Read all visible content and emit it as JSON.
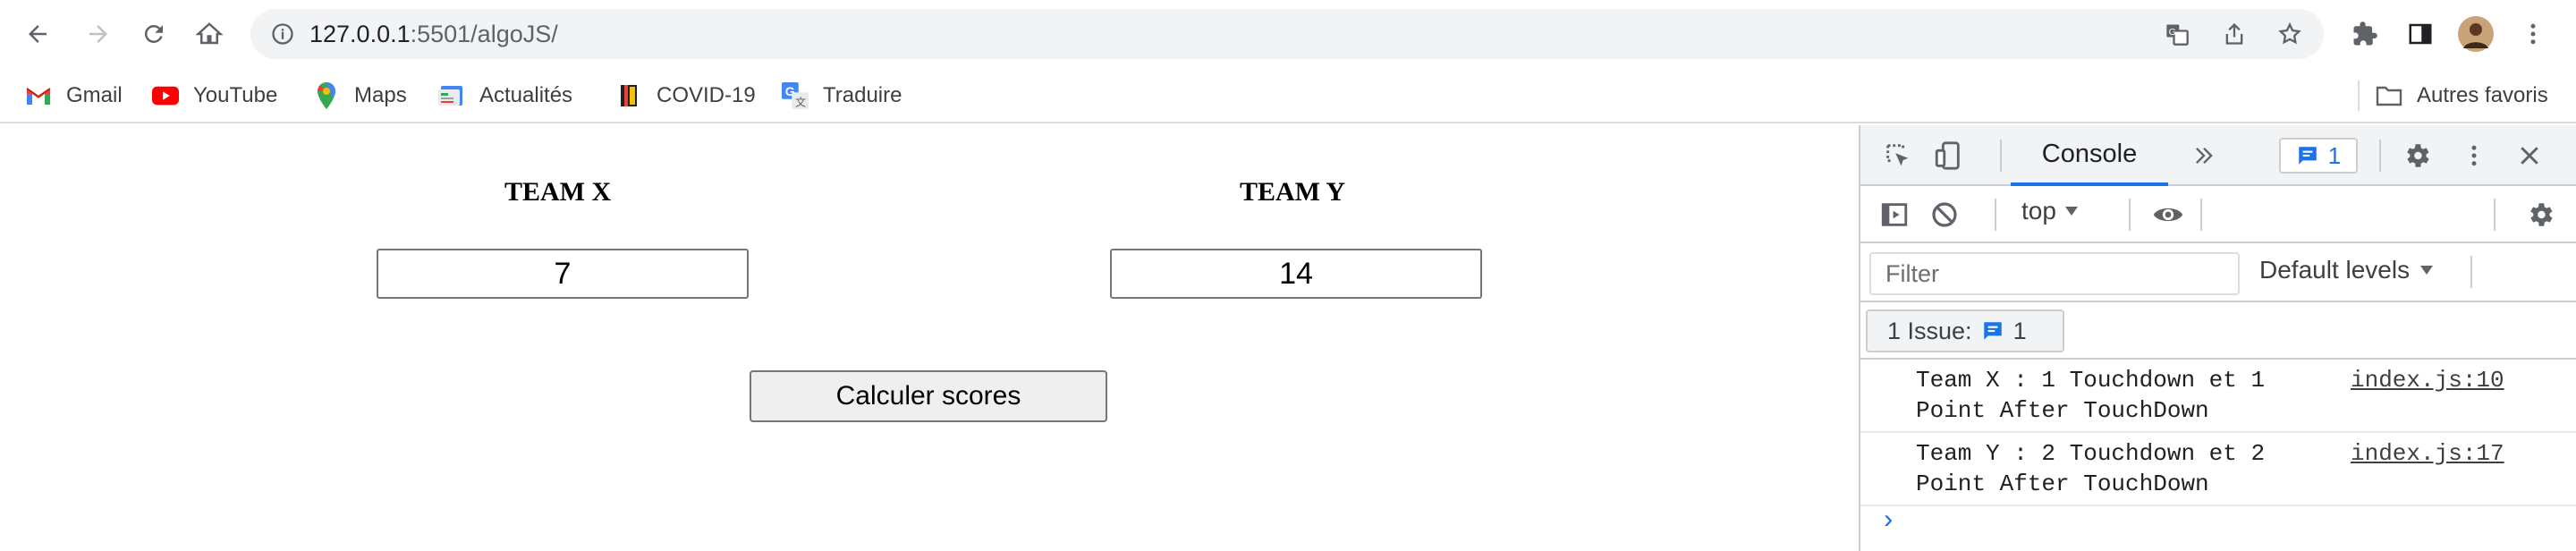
{
  "browser": {
    "url_host": "127.0.0.1",
    "url_rest": ":5501/algoJS/"
  },
  "bookmarks": {
    "items": [
      {
        "label": "Gmail",
        "icon": "gmail-icon"
      },
      {
        "label": "YouTube",
        "icon": "youtube-icon"
      },
      {
        "label": "Maps",
        "icon": "maps-icon"
      },
      {
        "label": "Actualités",
        "icon": "news-icon"
      },
      {
        "label": "COVID-19",
        "icon": "covid-icon"
      },
      {
        "label": "Traduire",
        "icon": "translate-icon"
      }
    ],
    "other": "Autres favoris"
  },
  "page": {
    "team_x": {
      "title": "TEAM X",
      "score": "7"
    },
    "team_y": {
      "title": "TEAM Y",
      "score": "14"
    },
    "calc_button": "Calculer scores"
  },
  "devtools": {
    "tab": "Console",
    "message_count": "1",
    "context": "top",
    "filter_placeholder": "Filter",
    "levels": "Default levels",
    "issues_label": "1 Issue:",
    "issues_count": "1",
    "messages": [
      {
        "text": "Team X : 1 Touchdown et 1 Point After TouchDown",
        "source": "index.js:10"
      },
      {
        "text": "Team Y : 2 Touchdown et 2 Point After TouchDown",
        "source": "index.js:17"
      }
    ],
    "prompt": "›"
  },
  "colors": {
    "accent": "#1a73e8",
    "youtube": "#ff0000",
    "toolbar_bg": "#f1f3f4"
  }
}
